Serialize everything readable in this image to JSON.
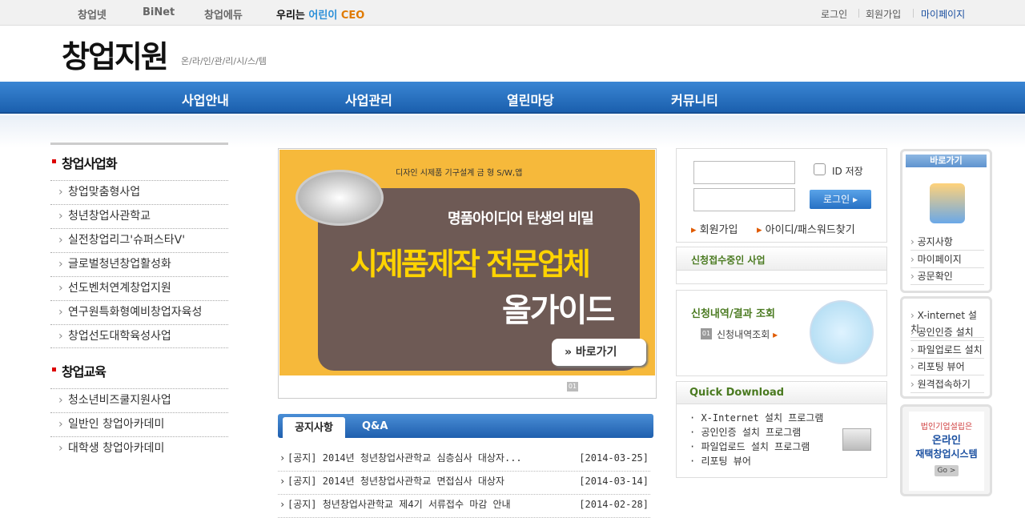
{
  "topbar": {
    "links": [
      "창업넷",
      "BiNet",
      "창업에듀"
    ],
    "ceo_prefix": "우리는 ",
    "ceo_highlight": "어린이",
    "ceo_suffix": " CEO",
    "login": "로그인",
    "join": "회원가입",
    "mypage": "마이페이지"
  },
  "logo": {
    "title": "창업지원",
    "subtitle": "온/라/인/관/리/시/스/템"
  },
  "gnb": [
    "사업안내",
    "사업관리",
    "열린마당",
    "커뮤니티"
  ],
  "lnb": {
    "section1": "창업사업화",
    "items1": [
      "창업맞춤형사업",
      "청년창업사관학교",
      "실전창업리그'슈퍼스타V'",
      "글로벌청년창업활성화",
      "선도벤처연계창업지원",
      "연구원특화형예비창업자육성",
      "창업선도대학육성사업"
    ],
    "section2": "창업교육",
    "items2": [
      "청소년비즈쿨지원사업",
      "일반인 창업아카데미",
      "대학생 창업아카데미"
    ]
  },
  "banner": {
    "tags": "디자인  시제품  기구설계  금 형  S/W,앱",
    "line1": "명품아이디어 탄생의 비밀",
    "line2": "시제품제작 전문업체",
    "line3": "올가이드",
    "go": "» 바로가기",
    "page": "01"
  },
  "board": {
    "tab_active": "공지사항",
    "tab_other": "Q&A",
    "rows": [
      {
        "title": "[공지] 2014년 청년창업사관학교 심층심사 대상자...",
        "date": "[2014-03-25]"
      },
      {
        "title": "[공지] 2014년 청년창업사관학교 면접심사 대상자",
        "date": "[2014-03-14]"
      },
      {
        "title": "[공지] 청년창업사관학교 제4기 서류접수 마감 안내",
        "date": "[2014-02-28]"
      }
    ]
  },
  "login": {
    "id_save": "ID 저장",
    "button": "로그인",
    "join": "회원가입",
    "find": "아이디/패스워드찾기"
  },
  "apply": {
    "header": "신청접수중인 사업"
  },
  "inquiry": {
    "header": "신청내역/결과 조회",
    "num": "01",
    "link": "신청내역조회"
  },
  "quick_download": {
    "header": "Quick Download",
    "items": [
      "X-Internet 설치 프로그램",
      "공인인증 설치 프로그램",
      "파일업로드 설치 프로그램",
      "리포팅 뷰어"
    ]
  },
  "shortcut": {
    "header": "바로가기",
    "items": [
      "공지사항",
      "마이페이지",
      "공문확인"
    ],
    "tools": [
      "X-internet 설치",
      "공인인증 설치",
      "파일업로드 설치",
      "리포팅 뷰어",
      "원격접속하기"
    ]
  },
  "promo": {
    "line1": "법인기업설립은",
    "line2": "온라인",
    "line3": "재택창업시스템",
    "go": "Go >"
  }
}
